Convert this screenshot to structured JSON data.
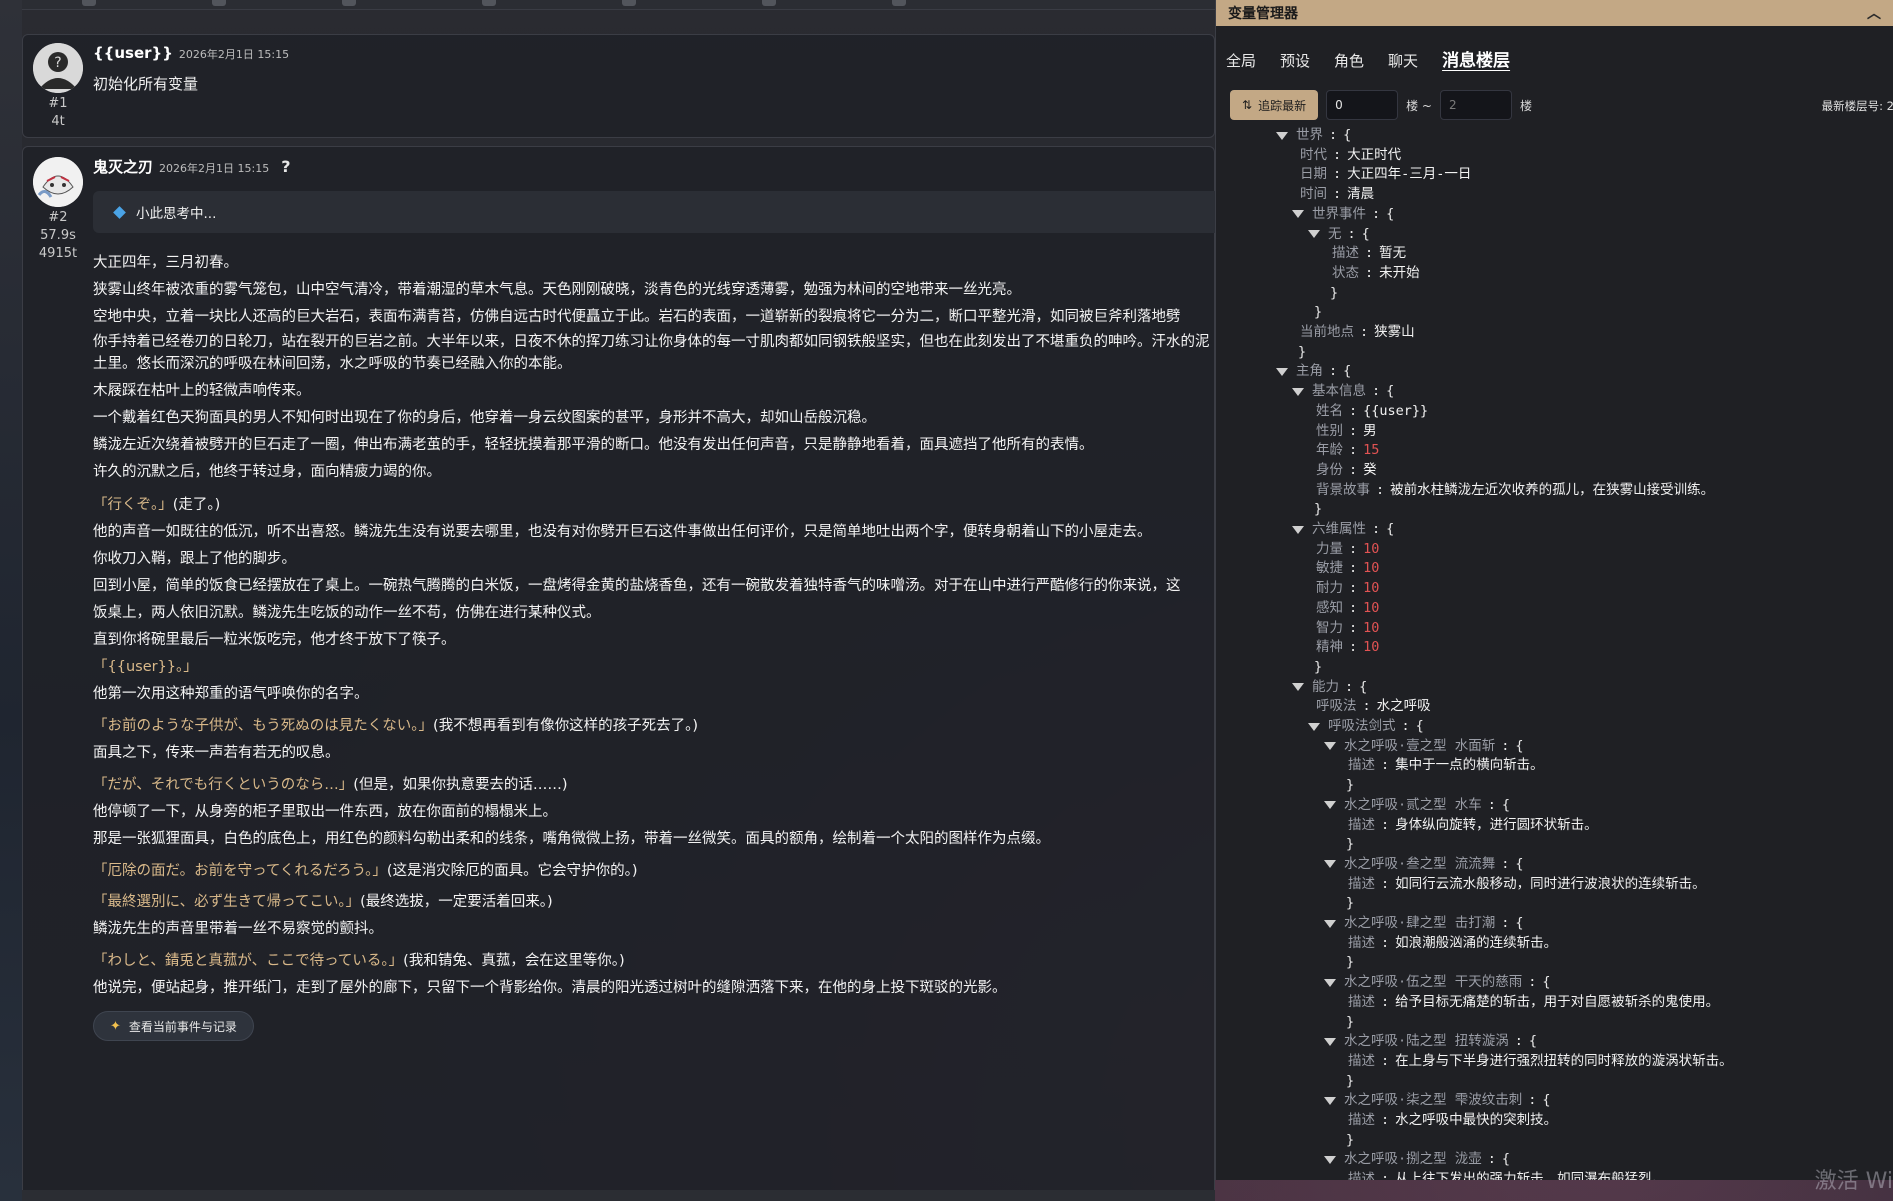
{
  "messages": [
    {
      "user": "{{user}}",
      "time": "2026年2月1日 15:15",
      "index": "#1",
      "tokens": "4t",
      "text": "初始化所有变量"
    },
    {
      "user": "鬼灭之刃",
      "time": "2026年2月1日 15:15",
      "index": "#2",
      "duration": "57.9s",
      "tokens": "4915t",
      "help_icon": "?",
      "thinking": "小此思考中...",
      "paragraphs": [
        "大正四年，三月初春。",
        "狭雾山终年被浓重的雾气笼包，山中空气清冷，带着潮湿的草木气息。天色刚刚破晓，淡青色的光线穿透薄雾，勉强为林间的空地带来一丝光亮。",
        "空地中央，立着一块比人还高的巨大岩石，表面布满青苔，仿佛自远古时代便矗立于此。岩石的表面，一道崭新的裂痕将它一分为二，断口平整光滑，如同被巨斧利落地劈",
        "你手持着已经卷刃的日轮刀，站在裂开的巨岩之前。大半年以来，日夜不休的挥刀练习让你身体的每一寸肌肉都如同钢铁般坚实，但也在此刻发出了不堪重负的呻吟。汗水的泥土里。悠长而深沉的呼吸在林间回荡，水之呼吸的节奏已经融入你的本能。",
        "木屐踩在枯叶上的轻微声响传来。",
        "一个戴着红色天狗面具的男人不知何时出现在了你的身后，他穿着一身云纹图案的甚平，身形并不高大，却如山岳般沉稳。",
        "鳞泷左近次绕着被劈开的巨石走了一圈，伸出布满老茧的手，轻轻抚摸着那平滑的断口。他没有发出任何声音，只是静静地看着，面具遮挡了他所有的表情。",
        "许久的沉默之后，他终于转过身，面向精疲力竭的你。",
        "「行くぞ。」",
        "(走了。)",
        "他的声音一如既往的低沉，听不出喜怒。鳞泷先生没有说要去哪里，也没有对你劈开巨石这件事做出任何评价，只是简单地吐出两个字，便转身朝着山下的小屋走去。",
        "你收刀入鞘，跟上了他的脚步。",
        "回到小屋，简单的饭食已经摆放在了桌上。一碗热气腾腾的白米饭，一盘烤得金黄的盐烧香鱼，还有一碗散发着独特香气的味噌汤。对于在山中进行严酷修行的你来说，这",
        "饭桌上，两人依旧沉默。鳞泷先生吃饭的动作一丝不苟，仿佛在进行某种仪式。",
        "直到你将碗里最后一粒米饭吃完，他才终于放下了筷子。",
        "「{{user}}。」",
        "他第一次用这种郑重的语气呼唤你的名字。",
        "「お前のような子供が、もう死ぬのは見たくない。」",
        "(我不想再看到有像你这样的孩子死去了。)",
        "面具之下，传来一声若有若无的叹息。",
        "「だが、それでも行くというのなら…」",
        "(但是，如果你执意要去的话……)",
        "他停顿了一下，从身旁的柜子里取出一件东西，放在你面前的榻榻米上。",
        "那是一张狐狸面具，白色的底色上，用红色的颜料勾勒出柔和的线条，嘴角微微上扬，带着一丝微笑。面具的额角，绘制着一个太阳的图样作为点缀。",
        "「厄除の面だ。お前を守ってくれるだろう。」",
        "(这是消灾除厄的面具。它会守护你的。)",
        "「最終選別に、必ず生きて帰ってこい。」",
        "(最终选拔，一定要活着回来。)",
        "鳞泷先生的声音里带着一丝不易察觉的颤抖。",
        "「わしと、錆兎と真菰が、ここで待っている。」",
        "(我和锖兔、真菰，会在这里等你。)",
        "他说完，便站起身，推开纸门，走到了屋外的廊下，只留下一个背影给你。清晨的阳光透过树叶的缝隙洒落下来，在他的身上投下斑驳的光影。"
      ],
      "event_button": "查看当前事件与记录"
    }
  ],
  "panel": {
    "title": "变量管理器",
    "tabs": [
      "全局",
      "预设",
      "角色",
      "聊天",
      "消息楼层"
    ],
    "track_label": "追踪最新",
    "floor_from": "0",
    "floor_sep": "楼 ~",
    "floor_to_placeholder": "2",
    "floor_unit": "楼",
    "latest_label": "最新楼层号: 2",
    "tree": {
      "world": {
        "key": "世界",
        "era_k": "时代",
        "era_v": "大正时代",
        "date_k": "日期",
        "date_v": "大正四年-三月-一日",
        "time_k": "时间",
        "time_v": "清晨",
        "events_k": "世界事件",
        "none_k": "无",
        "desc_k": "描述",
        "desc_v": "暂无",
        "state_k": "状态",
        "state_v": "未开始",
        "loc_k": "当前地点",
        "loc_v": "狭雾山"
      },
      "hero": {
        "key": "主角",
        "basic_k": "基本信息",
        "name_k": "姓名",
        "name_v": "{{user}}",
        "sex_k": "性别",
        "sex_v": "男",
        "age_k": "年龄",
        "age_v": "15",
        "id_k": "身份",
        "id_v": "癸",
        "bg_k": "背景故事",
        "bg_v": "被前水柱鳞泷左近次收养的孤儿，在狭雾山接受训练。",
        "attr_k": "六维属性",
        "str_k": "力量",
        "str_v": "10",
        "agi_k": "敏捷",
        "agi_v": "10",
        "end_k": "耐力",
        "end_v": "10",
        "per_k": "感知",
        "per_v": "10",
        "int_k": "智力",
        "int_v": "10",
        "spi_k": "精神",
        "spi_v": "10",
        "abil_k": "能力",
        "breath_k": "呼吸法",
        "breath_v": "水之呼吸",
        "forms_k": "呼吸法剑式",
        "forms": [
          {
            "name": "水之呼吸·壹之型 水面斩",
            "desc": "集中于一点的横向斩击。"
          },
          {
            "name": "水之呼吸·贰之型 水车",
            "desc": "身体纵向旋转，进行圆环状斩击。"
          },
          {
            "name": "水之呼吸·叁之型 流流舞",
            "desc": "如同行云流水般移动，同时进行波浪状的连续斩击。"
          },
          {
            "name": "水之呼吸·肆之型 击打潮",
            "desc": "如浪潮般汹涌的连续斩击。"
          },
          {
            "name": "水之呼吸·伍之型 干天的慈雨",
            "desc": "给予目标无痛楚的斩击，用于对自愿被斩杀的鬼使用。"
          },
          {
            "name": "水之呼吸·陆之型 扭转漩涡",
            "desc": "在上身与下半身进行强烈扭转的同时释放的漩涡状斩击。"
          },
          {
            "name": "水之呼吸·柒之型 雫波纹击刺",
            "desc": "水之呼吸中最快的突刺技。"
          },
          {
            "name": "水之呼吸·捌之型 泷壶",
            "desc": "从上往下发出的强力斩击，如同瀑布般猛烈。"
          }
        ]
      }
    }
  },
  "watermark": "激活 Wi",
  "colors": {
    "accent": "#c3a885",
    "number": "#e25353",
    "key": "#9a9da6",
    "quote": "#d9b98a"
  }
}
